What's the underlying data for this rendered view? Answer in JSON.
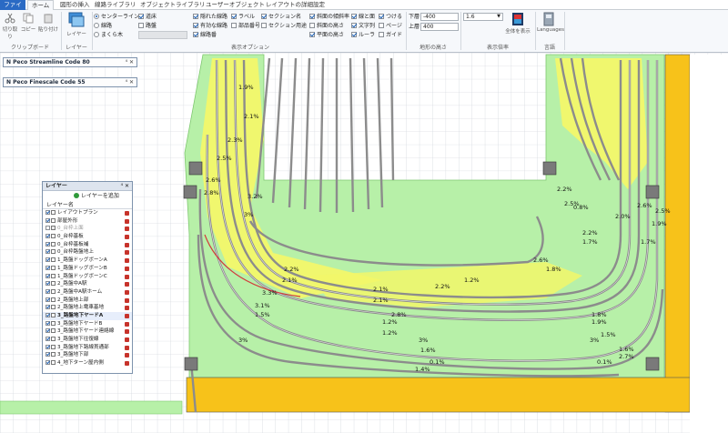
{
  "tabs": [
    {
      "label": "ファイル"
    },
    {
      "label": "ホーム"
    },
    {
      "label": "図形の挿入"
    },
    {
      "label": "線路ライブラリ"
    },
    {
      "label": "オブジェクトライブラリ"
    },
    {
      "label": "ユーザーオブジェクト"
    },
    {
      "label": "レイアウトの詳細設定"
    }
  ],
  "clipboard": {
    "cut": "切り取り",
    "copy": "コピー",
    "paste": "貼り付け",
    "group": "クリップボード"
  },
  "layer_group": {
    "button": "レイヤー",
    "group": "レイヤー"
  },
  "radios": [
    "センターライン",
    "線路",
    "まくら木"
  ],
  "options_col1": [
    "道床",
    "路盤",
    ""
  ],
  "options_col2": [
    "隠れた線路",
    "有効な線路",
    "線路番"
  ],
  "options_col3": [
    "ラベル",
    "部品番号"
  ],
  "options_col4": [
    "セクション名",
    "セクション用途"
  ],
  "options_col5": [
    "斜面の傾斜率",
    "斜面の高さ",
    "平面の高さ"
  ],
  "options_col6": [
    "線と面",
    "文字列",
    "ルーラ"
  ],
  "options_col7": [
    "つける",
    "ページ",
    "ガイド"
  ],
  "display_options_label": "表示オプション",
  "height": {
    "lower_label": "下層",
    "lower_value": "-400",
    "upper_label": "上層",
    "upper_value": "400",
    "group": "地形の高さ"
  },
  "scale": {
    "value": "1.6",
    "show_all": "全体を表示",
    "group": "表示倍率"
  },
  "language": {
    "button": "Languages",
    "group": "言語"
  },
  "panels": {
    "streamline": "N Peco Streamline Code 80",
    "finescale": "N Peco Finescale Code 55",
    "pin": "⁴ ✕"
  },
  "layers_panel": {
    "title": "レイヤー",
    "controls": "⁴ ✕",
    "add_button": "レイヤーを追加",
    "col_header": "レイヤー名",
    "rows": [
      {
        "name": "レイアウトプラン",
        "checked": true,
        "state": "normal"
      },
      {
        "name": "部屋外形",
        "checked": true,
        "state": "normal"
      },
      {
        "name": "0_台枠上面",
        "checked": false,
        "state": "dim"
      },
      {
        "name": "0_台枠基板",
        "checked": true,
        "state": "normal"
      },
      {
        "name": "0_台枠基板補",
        "checked": true,
        "state": "normal"
      },
      {
        "name": "0_台枠路盤地上",
        "checked": true,
        "state": "normal"
      },
      {
        "name": "1_路盤ドッグボーンA",
        "checked": true,
        "state": "normal"
      },
      {
        "name": "1_路盤ドッグボーンB",
        "checked": true,
        "state": "normal"
      },
      {
        "name": "1_路盤ドッグボーンC",
        "checked": true,
        "state": "normal"
      },
      {
        "name": "2_路盤中A駅",
        "checked": true,
        "state": "normal"
      },
      {
        "name": "2_路盤中A駅ホーム",
        "checked": true,
        "state": "normal"
      },
      {
        "name": "2_路盤地上部",
        "checked": true,
        "state": "normal"
      },
      {
        "name": "2_路盤地上電車基地",
        "checked": true,
        "state": "normal"
      },
      {
        "name": "3_路盤地下ヤードA",
        "checked": true,
        "state": "bold"
      },
      {
        "name": "3_路盤地下ヤードB",
        "checked": true,
        "state": "normal"
      },
      {
        "name": "3_路盤地下ヤード連絡線",
        "checked": true,
        "state": "normal"
      },
      {
        "name": "3_路盤地下往復線",
        "checked": true,
        "state": "normal"
      },
      {
        "name": "3_路盤地下路線貫通部",
        "checked": true,
        "state": "normal"
      },
      {
        "name": "3_路盤地下部",
        "checked": true,
        "state": "normal"
      },
      {
        "name": "4_地下ターン屋内側",
        "checked": true,
        "state": "normal"
      }
    ]
  },
  "grade_labels": [
    "1.9%",
    "2.1%",
    "2.3%",
    "2.5%",
    "2.6%",
    "2.8%",
    "3%",
    "3.2%",
    "2.2%",
    "2.1%",
    "3.3%",
    "3.1%",
    "1.5%",
    "2.1%",
    "2.2%",
    "2.1%",
    "2.8%",
    "1.2%",
    "1.2%",
    "3%",
    "1.6%",
    "0.1%",
    "1.4%",
    "1.2%",
    "1.8%",
    "1.9%",
    "1.5%",
    "3%",
    "1.6%",
    "0.1%",
    "2.7%",
    "3%",
    "2.2%",
    "2.5%",
    "0.8%",
    "1.7%",
    "2.6%",
    "1.8%",
    "2.0%",
    "2.6%",
    "2.5%",
    "1.9%",
    "1.7%",
    "2.2%"
  ],
  "colors": {
    "board": "#b7f0a8",
    "grade": "#f2f76a",
    "wall": "#f7c21a",
    "track": "#8c8c8c",
    "rib": "#2a6ac4"
  }
}
